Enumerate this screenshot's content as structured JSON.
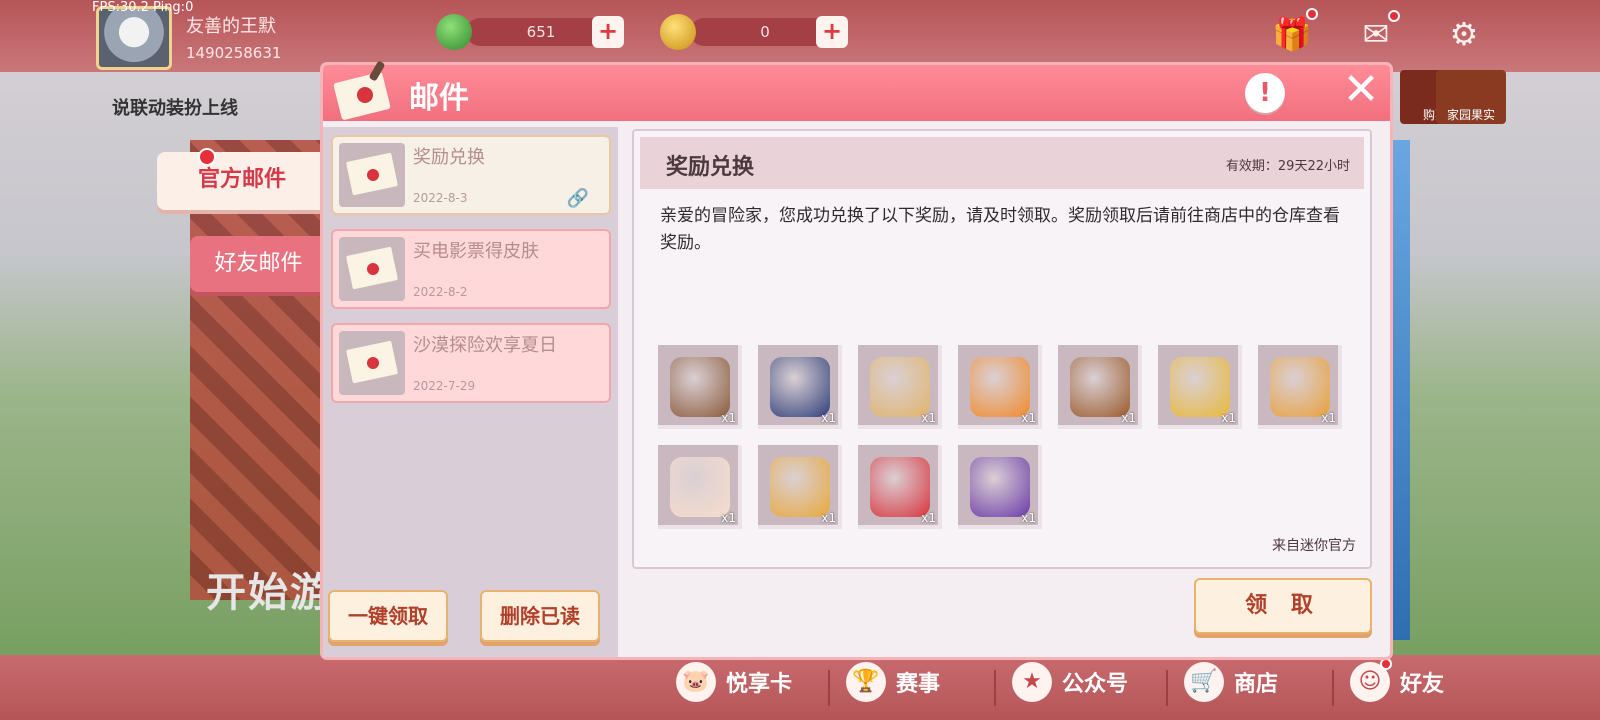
{
  "hud": {
    "fps": "FPS:30.2  Ping:0"
  },
  "player": {
    "name": "友善的王默",
    "id": "1490258631"
  },
  "currencies": [
    {
      "value": "651",
      "icon": "green-gem-icon",
      "color": "#3e9a3a"
    },
    {
      "value": "0",
      "icon": "gold-coin-icon",
      "color": "#e6b12c"
    }
  ],
  "top_icons": [
    "gift-icon",
    "mail-icon",
    "gear-icon"
  ],
  "news": "说联动装扮上线",
  "right_buttons": [
    "购票",
    "家园果实"
  ],
  "background_text": "开始游",
  "tabs": {
    "official": "官方邮件",
    "friend": "好友邮件"
  },
  "mail": {
    "title": "邮件",
    "info": "!",
    "close": "✕",
    "list": [
      {
        "title": "奖励兑换",
        "date": "2022-8-3",
        "attachment": true
      },
      {
        "title": "买电影票得皮肤",
        "date": "2022-8-2",
        "attachment": false
      },
      {
        "title": "沙漠探险欢享夏日",
        "date": "2022-7-29",
        "attachment": false
      }
    ],
    "buttons": {
      "claim_all": "一键领取",
      "delete_read": "删除已读",
      "claim": "领 取"
    },
    "detail": {
      "title": "奖励兑换",
      "expiry": "有效期：29天22小时",
      "body": "亲爱的冒险家，您成功兑换了以下奖励，请及时领取。奖励领取后请前往商店中的仓库查看奖励。",
      "from": "来自迷你官方",
      "rewards": [
        {
          "qty": "x1",
          "icon": "boots-icon",
          "color": "#8a5a3a"
        },
        {
          "qty": "x1",
          "icon": "witch-avatar-icon",
          "color": "#2f3f7a"
        },
        {
          "qty": "x1",
          "icon": "jacket-icon",
          "color": "#e0b46a"
        },
        {
          "qty": "x1",
          "icon": "carrot-icon",
          "color": "#f08a2a"
        },
        {
          "qty": "x1",
          "icon": "lion-hair-icon",
          "color": "#9a5a2a"
        },
        {
          "qty": "x1",
          "icon": "gloves-icon",
          "color": "#e8b83a"
        },
        {
          "qty": "x1",
          "icon": "sparkle-effect-icon",
          "color": "#e8a03a"
        },
        {
          "qty": "x1",
          "icon": "face-icon",
          "color": "#f6dccc"
        },
        {
          "qty": "x1",
          "icon": "avatar-frame-icon",
          "color": "#e8a83a"
        },
        {
          "qty": "x1",
          "icon": "gift-box-icon",
          "color": "#d8343d"
        },
        {
          "qty": "x1",
          "icon": "mystery-bag-icon",
          "color": "#6a3aa8"
        }
      ]
    }
  },
  "bottom_nav": [
    {
      "label": "悦享卡",
      "icon": "pig-icon"
    },
    {
      "label": "赛事",
      "icon": "trophy-icon"
    },
    {
      "label": "公众号",
      "icon": "star-badge-icon"
    },
    {
      "label": "商店",
      "icon": "cart-icon"
    },
    {
      "label": "好友",
      "icon": "friend-icon"
    }
  ]
}
